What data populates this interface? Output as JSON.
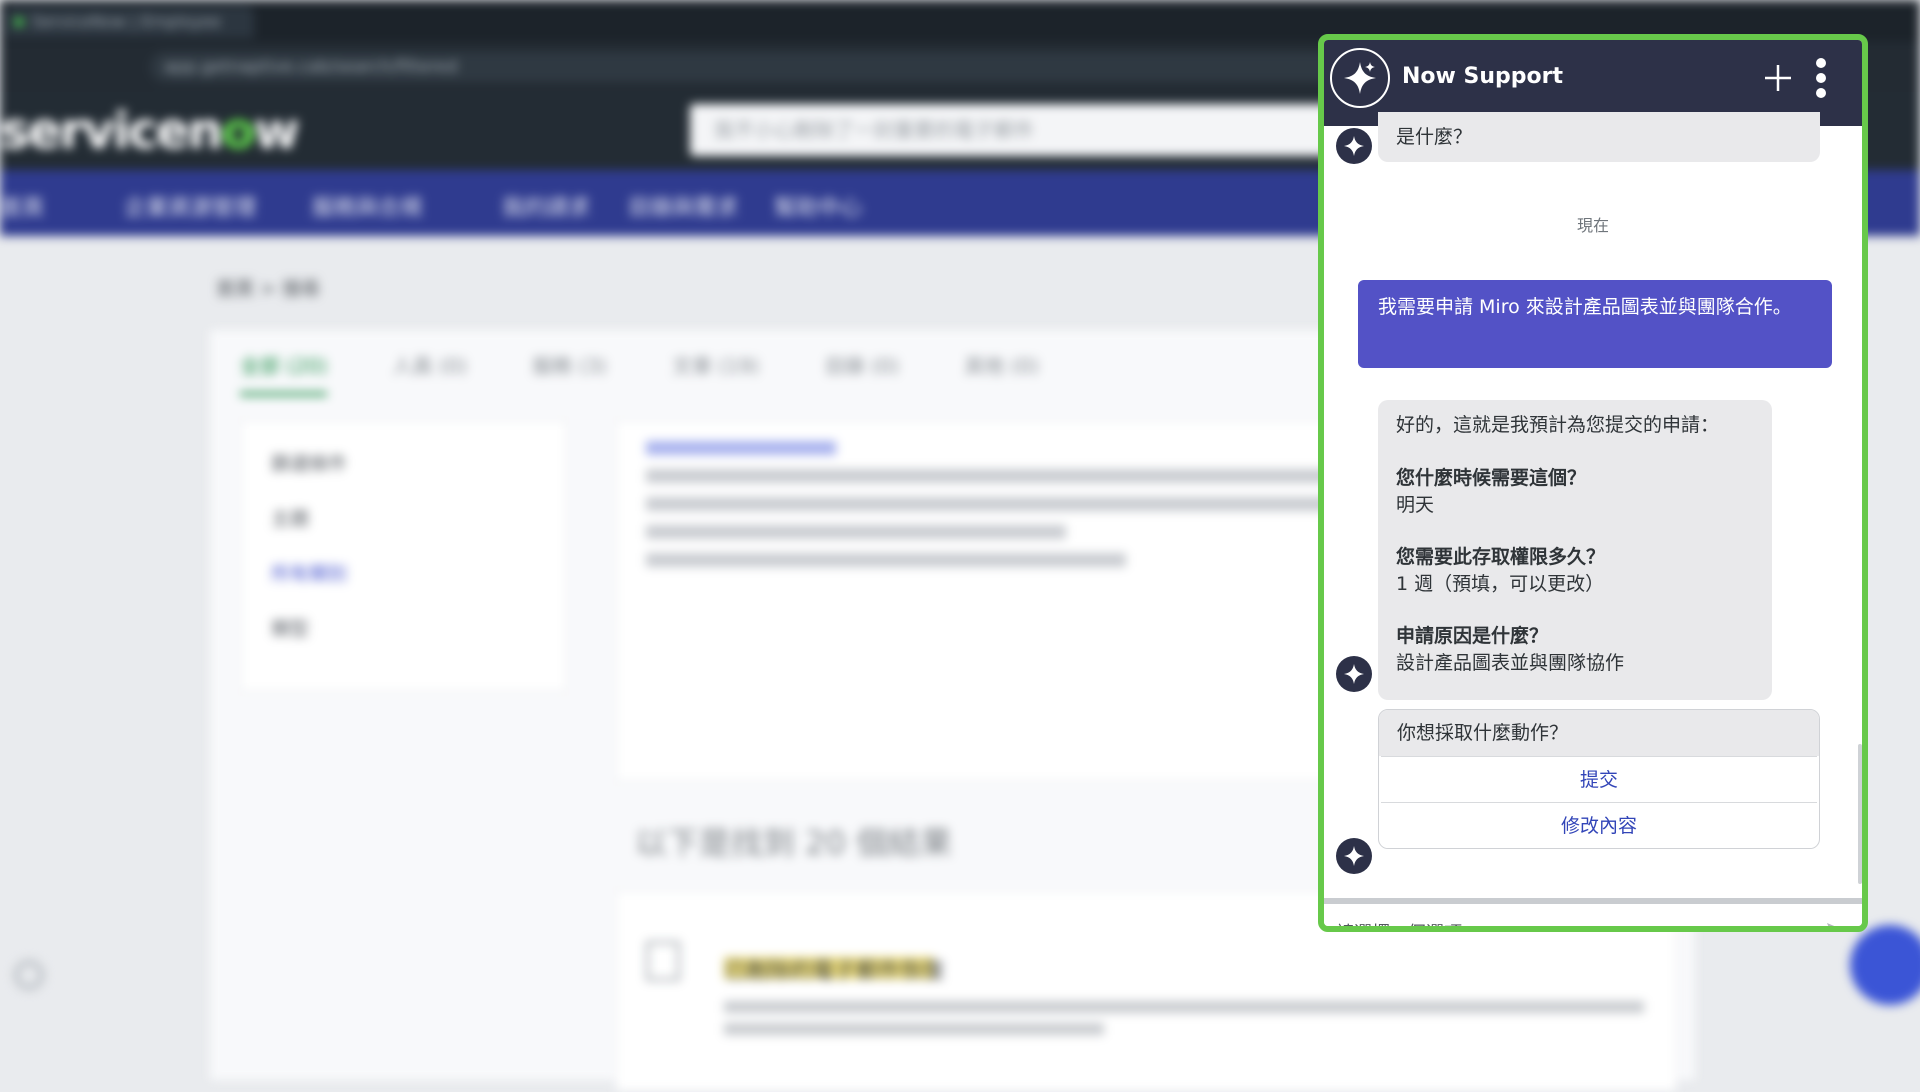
{
  "browser": {
    "tab_title": "ServiceNow | Employee Center",
    "url": "app.getnaptive.cab/search/filtered"
  },
  "page": {
    "brand_prefix": "servicen",
    "brand_o": "o",
    "brand_suffix": "w",
    "search_placeholder": "我不小心刪除了一封重要的電子郵件",
    "nav": [
      "首頁",
      "企業資源管理",
      "服務與合規",
      "我的請求",
      "目錄與需求",
      "幫助中心"
    ],
    "breadcrumb": "首頁  >  搜尋",
    "tabs": [
      "全部 (20)",
      "人員 (0)",
      "服務 (3)",
      "文章 (19)",
      "目錄 (0)",
      "其他 (0)"
    ],
    "filter_title": "篩選條件",
    "filter_items": [
      "主題",
      "所有類別",
      "類型"
    ],
    "result_heading": "以下是找到 20 個結果",
    "result_title": "已刪除的電子郵件恢復"
  },
  "chat": {
    "title": "Now Support",
    "partial_message": "是什麼？",
    "timestamp": "現在",
    "user_message": "我需要申請 Miro 來設計產品圖表並與團隊合作。",
    "summary": {
      "intro": "好的，這就是我預計為您提交的申請：",
      "q1": "您什麼時候需要這個？",
      "a1": "明天",
      "q2": "您需要此存取權限多久？",
      "a2": "1 週（預填，可以更改）",
      "q3": "申請原因是什麼？",
      "a3": "設計產品圖表並與團隊協作"
    },
    "action_question": "你想採取什麼動作？",
    "actions": [
      "提交",
      "修改內容"
    ],
    "input_placeholder": "請選擇一個選項。"
  },
  "colors": {
    "highlight_border": "#67c94a",
    "chat_header": "#2d3148",
    "user_bubble": "#5352c6",
    "bot_bubble": "#e9e9eb",
    "action_link": "#3245b8"
  },
  "icons": [
    "sparkle-icon",
    "plus-icon",
    "more-vertical-icon",
    "send-icon",
    "settings-icon",
    "chat-bubble-icon"
  ]
}
